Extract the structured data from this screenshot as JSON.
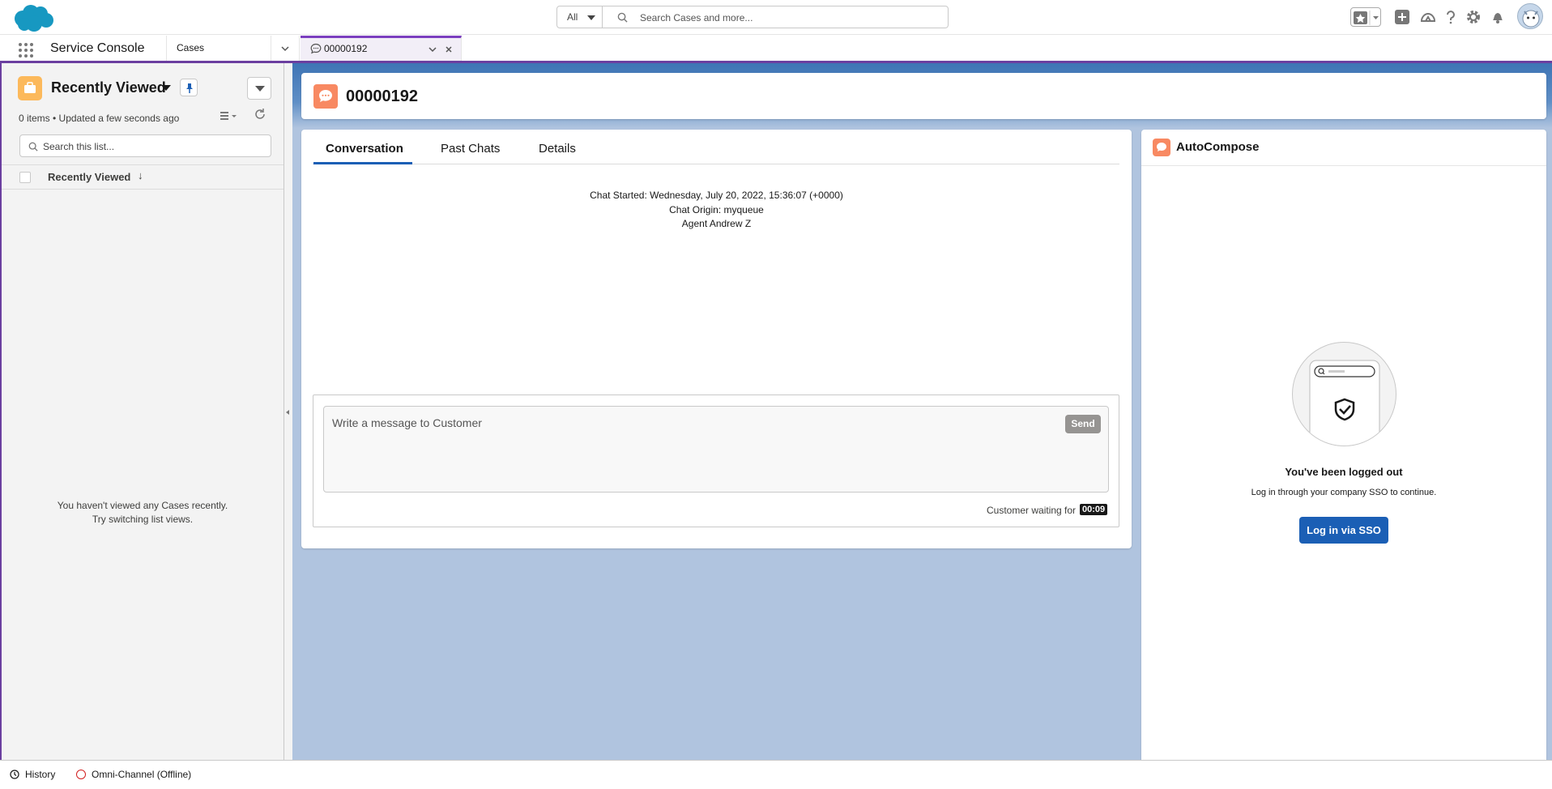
{
  "header": {
    "search_scope": "All",
    "search_placeholder": "Search Cases and more..."
  },
  "nav": {
    "app_name": "Service Console",
    "object_item": "Cases",
    "open_tab": "00000192"
  },
  "list_view": {
    "title": "Recently Viewed",
    "meta": "0 items • Updated a few seconds ago",
    "search_placeholder": "Search this list...",
    "column_header": "Recently Viewed",
    "empty_line1": "You haven't viewed any Cases recently.",
    "empty_line2": "Try switching list views."
  },
  "record": {
    "title": "00000192",
    "tabs": [
      "Conversation",
      "Past Chats",
      "Details"
    ],
    "active_tab": "Conversation",
    "chat_started": "Chat Started: Wednesday, July 20, 2022, 15:36:07 (+0000)",
    "chat_origin": "Chat Origin: myqueue",
    "agent": "Agent Andrew Z",
    "composer_placeholder": "Write a message to Customer",
    "send_label": "Send",
    "waiting_label": "Customer waiting for",
    "waiting_time": "00:09"
  },
  "autocompose": {
    "title": "AutoCompose",
    "logged_out_title": "You've been logged out",
    "logged_out_text": "Log in through your company SSO to continue.",
    "sso_button": "Log in via SSO"
  },
  "utility_bar": {
    "history": "History",
    "omni": "Omni-Channel (Offline)"
  },
  "colors": {
    "brand_blue": "#1b5fb5",
    "tab_accent": "#7b3fbf",
    "chat_icon": "#f88962",
    "list_icon": "#fcb95b",
    "offline_red": "#d21f1f"
  },
  "icons": [
    "salesforce-cloud-logo",
    "search-icon",
    "favorites-star-icon",
    "add-icon",
    "trailhead-icon",
    "help-icon",
    "setup-gear-icon",
    "bell-icon",
    "astro-avatar",
    "waffle-icon",
    "chevron-down-icon",
    "chat-icon",
    "close-icon",
    "pin-icon",
    "list-view-icon",
    "refresh-icon",
    "shield-check-icon",
    "clock-icon"
  ]
}
